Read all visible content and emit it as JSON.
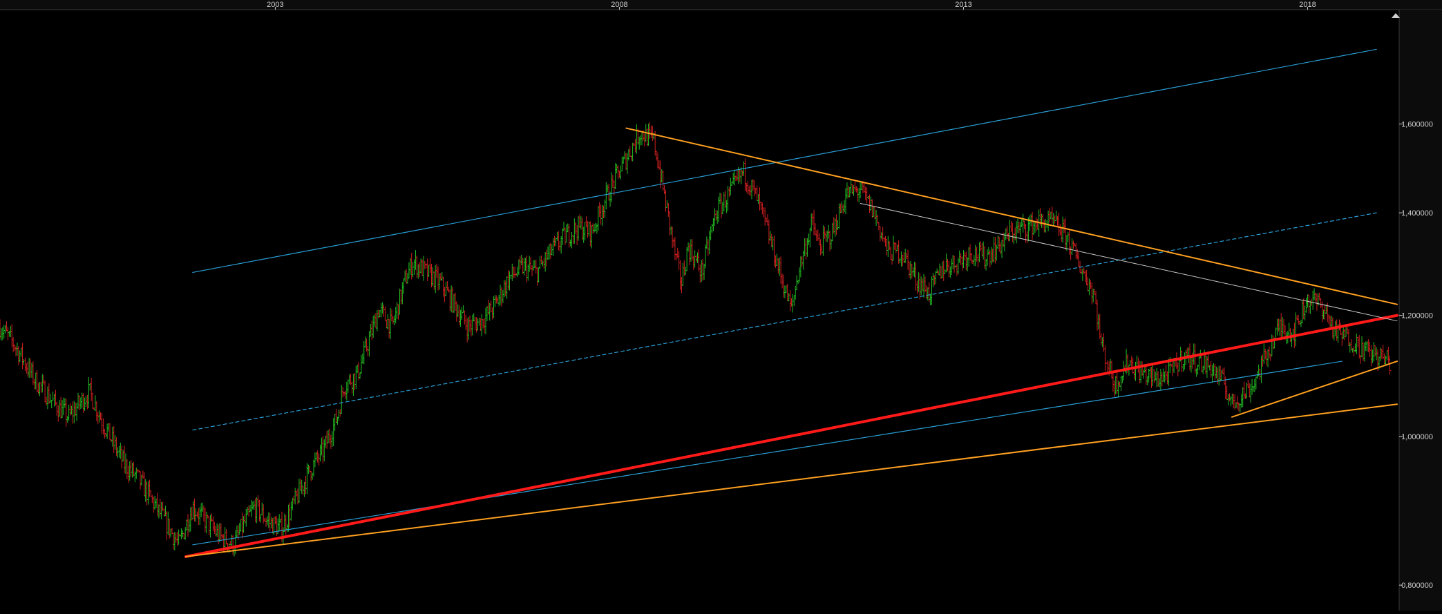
{
  "chart_data": {
    "type": "candlestick",
    "title": "",
    "xlabel": "",
    "ylabel": "",
    "log_scale": true,
    "x_tick_labels": [
      "2003",
      "2008",
      "2013",
      "2018"
    ],
    "x_ticks": [
      2003,
      2008,
      2013,
      2018
    ],
    "xlim": [
      1999.0,
      2019.3
    ],
    "y_tick_labels": [
      "1,600000",
      "1,400000",
      "1,200000",
      "1,000000",
      "0,800000"
    ],
    "y_ticks": [
      1.6,
      1.4,
      1.2,
      1.0,
      0.8
    ],
    "ylim": [
      0.77,
      1.9
    ],
    "grid": false,
    "legend": "none",
    "colors": {
      "background": "#000000",
      "up_bar": "#22c022",
      "down_bar": "#d42020",
      "axis_text": "#d0d0d0",
      "axis_line": "#3a3a3a",
      "channel_blue": "#2a9fd6",
      "trend_red": "#ff1a1a",
      "trend_orange": "#ffa020",
      "trend_white": "#c8c8c8"
    },
    "price_path": [
      [
        1999.0,
        1.18
      ],
      [
        1999.2,
        1.15
      ],
      [
        1999.5,
        1.09
      ],
      [
        1999.8,
        1.05
      ],
      [
        2000.0,
        1.03
      ],
      [
        2000.3,
        1.07
      ],
      [
        2000.5,
        1.02
      ],
      [
        2000.8,
        0.96
      ],
      [
        2001.0,
        0.94
      ],
      [
        2001.2,
        0.91
      ],
      [
        2001.4,
        0.88
      ],
      [
        2001.6,
        0.85
      ],
      [
        2001.8,
        0.9
      ],
      [
        2002.0,
        0.88
      ],
      [
        2002.2,
        0.86
      ],
      [
        2002.4,
        0.85
      ],
      [
        2002.5,
        0.87
      ],
      [
        2002.7,
        0.9
      ],
      [
        2002.9,
        0.88
      ],
      [
        2003.1,
        0.87
      ],
      [
        2003.3,
        0.91
      ],
      [
        2003.5,
        0.95
      ],
      [
        2003.7,
        0.98
      ],
      [
        2003.9,
        1.03
      ],
      [
        2004.0,
        1.08
      ],
      [
        2004.2,
        1.1
      ],
      [
        2004.4,
        1.17
      ],
      [
        2004.5,
        1.21
      ],
      [
        2004.7,
        1.18
      ],
      [
        2004.9,
        1.27
      ],
      [
        2005.0,
        1.3
      ],
      [
        2005.2,
        1.28
      ],
      [
        2005.4,
        1.26
      ],
      [
        2005.6,
        1.22
      ],
      [
        2005.8,
        1.18
      ],
      [
        2006.0,
        1.19
      ],
      [
        2006.2,
        1.22
      ],
      [
        2006.4,
        1.27
      ],
      [
        2006.6,
        1.29
      ],
      [
        2006.8,
        1.28
      ],
      [
        2007.0,
        1.32
      ],
      [
        2007.2,
        1.35
      ],
      [
        2007.4,
        1.37
      ],
      [
        2007.6,
        1.36
      ],
      [
        2007.8,
        1.43
      ],
      [
        2007.9,
        1.46
      ],
      [
        2008.1,
        1.52
      ],
      [
        2008.3,
        1.58
      ],
      [
        2008.5,
        1.56
      ],
      [
        2008.6,
        1.48
      ],
      [
        2008.7,
        1.4
      ],
      [
        2008.8,
        1.32
      ],
      [
        2008.9,
        1.26
      ],
      [
        2009.0,
        1.33
      ],
      [
        2009.2,
        1.28
      ],
      [
        2009.4,
        1.4
      ],
      [
        2009.6,
        1.44
      ],
      [
        2009.8,
        1.49
      ],
      [
        2010.0,
        1.43
      ],
      [
        2010.2,
        1.34
      ],
      [
        2010.4,
        1.25
      ],
      [
        2010.5,
        1.21
      ],
      [
        2010.6,
        1.28
      ],
      [
        2010.8,
        1.38
      ],
      [
        2010.9,
        1.33
      ],
      [
        2011.1,
        1.36
      ],
      [
        2011.3,
        1.44
      ],
      [
        2011.5,
        1.45
      ],
      [
        2011.7,
        1.4
      ],
      [
        2011.9,
        1.32
      ],
      [
        2012.1,
        1.32
      ],
      [
        2012.3,
        1.27
      ],
      [
        2012.5,
        1.24
      ],
      [
        2012.7,
        1.29
      ],
      [
        2012.9,
        1.3
      ],
      [
        2013.1,
        1.32
      ],
      [
        2013.3,
        1.31
      ],
      [
        2013.5,
        1.33
      ],
      [
        2013.7,
        1.36
      ],
      [
        2013.9,
        1.37
      ],
      [
        2014.1,
        1.38
      ],
      [
        2014.3,
        1.38
      ],
      [
        2014.5,
        1.35
      ],
      [
        2014.7,
        1.29
      ],
      [
        2014.9,
        1.24
      ],
      [
        2015.0,
        1.15
      ],
      [
        2015.2,
        1.08
      ],
      [
        2015.4,
        1.12
      ],
      [
        2015.6,
        1.1
      ],
      [
        2015.8,
        1.09
      ],
      [
        2016.0,
        1.1
      ],
      [
        2016.2,
        1.13
      ],
      [
        2016.4,
        1.12
      ],
      [
        2016.6,
        1.11
      ],
      [
        2016.8,
        1.08
      ],
      [
        2016.9,
        1.05
      ],
      [
        2017.0,
        1.06
      ],
      [
        2017.2,
        1.08
      ],
      [
        2017.4,
        1.13
      ],
      [
        2017.6,
        1.18
      ],
      [
        2017.8,
        1.17
      ],
      [
        2018.0,
        1.23
      ],
      [
        2018.2,
        1.22
      ],
      [
        2018.4,
        1.17
      ],
      [
        2018.6,
        1.16
      ],
      [
        2018.8,
        1.14
      ],
      [
        2019.0,
        1.13
      ],
      [
        2019.2,
        1.12
      ]
    ],
    "trendlines": [
      {
        "style": "blue_solid",
        "from": [
          2001.8,
          1.28
        ],
        "to": [
          2019.0,
          1.79
        ]
      },
      {
        "style": "blue_dashed",
        "from": [
          2001.8,
          1.01
        ],
        "to": [
          2019.0,
          1.4
        ]
      },
      {
        "style": "blue_solid",
        "from": [
          2001.8,
          0.85
        ],
        "to": [
          2018.5,
          1.12
        ]
      },
      {
        "style": "red_thick",
        "from": [
          2001.7,
          0.835
        ],
        "to": [
          2019.3,
          1.2
        ]
      },
      {
        "style": "orange",
        "from": [
          2001.7,
          0.835
        ],
        "to": [
          2019.3,
          1.05
        ]
      },
      {
        "style": "orange",
        "from": [
          2008.1,
          1.59
        ],
        "to": [
          2019.3,
          1.22
        ]
      },
      {
        "style": "orange",
        "from": [
          2016.9,
          1.03
        ],
        "to": [
          2019.3,
          1.12
        ]
      },
      {
        "style": "white",
        "from": [
          2011.5,
          1.42
        ],
        "to": [
          2019.3,
          1.19
        ]
      }
    ]
  }
}
